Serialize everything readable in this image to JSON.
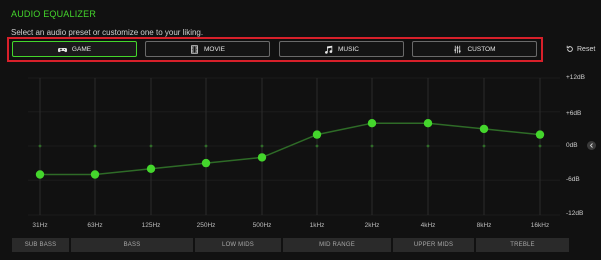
{
  "header": {
    "title": "AUDIO EQUALIZER",
    "subtitle": "Select an audio preset or customize one to your liking."
  },
  "presets": [
    {
      "label": "GAME",
      "icon": "gamepad-icon",
      "active": true
    },
    {
      "label": "MOVIE",
      "icon": "film-icon",
      "active": false
    },
    {
      "label": "MUSIC",
      "icon": "music-note-icon",
      "active": false
    },
    {
      "label": "CUSTOM",
      "icon": "sliders-icon",
      "active": false
    }
  ],
  "reset_label": "Reset",
  "db_scale": [
    "+12dB",
    "+6dB",
    "0dB",
    "-6dB",
    "-12dB"
  ],
  "bands": [
    {
      "freq": "31Hz",
      "gain_db": -5
    },
    {
      "freq": "63Hz",
      "gain_db": -5
    },
    {
      "freq": "125Hz",
      "gain_db": -4
    },
    {
      "freq": "250Hz",
      "gain_db": -3
    },
    {
      "freq": "500Hz",
      "gain_db": -2
    },
    {
      "freq": "1kHz",
      "gain_db": 2
    },
    {
      "freq": "2kHz",
      "gain_db": 4
    },
    {
      "freq": "4kHz",
      "gain_db": 4
    },
    {
      "freq": "8kHz",
      "gain_db": 3
    },
    {
      "freq": "16kHz",
      "gain_db": 2
    }
  ],
  "ranges": [
    "SUB BASS",
    "BASS",
    "LOW MIDS",
    "MID RANGE",
    "UPPER MIDS",
    "TREBLE"
  ],
  "colors": {
    "accent": "#44d62c",
    "highlight_box": "#d8202a",
    "line": "#2e6b27"
  }
}
